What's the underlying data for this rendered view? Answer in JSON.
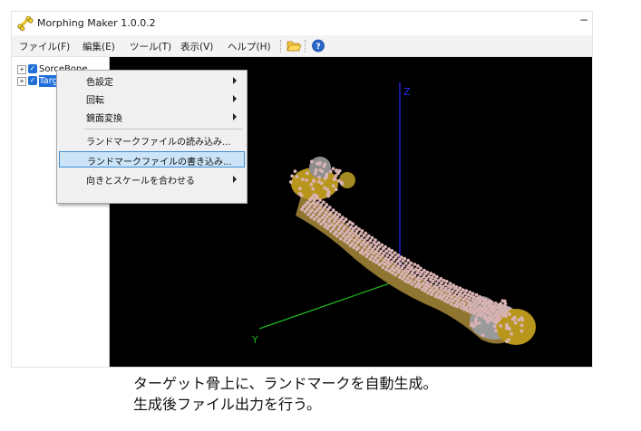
{
  "window": {
    "title": "Morphing Maker 1.0.0.2",
    "minimize_glyph": "−"
  },
  "menubar": {
    "items": [
      "ファイル(F)",
      "編集(E)",
      "ツール(T)",
      "表示(V)",
      "ヘルプ(H)"
    ],
    "toolbar": [
      {
        "name": "open-folder-icon"
      },
      {
        "name": "help-icon"
      }
    ]
  },
  "tree": {
    "items": [
      {
        "label": "SorceBone",
        "checked": true,
        "expander": "+"
      },
      {
        "label": "TargetBone",
        "checked": true,
        "expander": "+",
        "selected": true
      }
    ]
  },
  "viewport": {
    "axes": {
      "z": "Z",
      "y": "Y"
    },
    "colors": {
      "background": "#000000",
      "z_axis": "#2a2aff",
      "y_axis": "#1fb51f",
      "x_axis": "#8a1f1f",
      "bone_gold": "#b8961c",
      "bone_grey": "#9a9a9a",
      "landmark": "#d9b3b3"
    }
  },
  "context_menu": {
    "items": [
      {
        "label": "色設定",
        "submenu": true
      },
      {
        "label": "回転",
        "submenu": true
      },
      {
        "label": "鏡面変換",
        "submenu": true
      },
      {
        "label": "ランドマークファイルの読み込み...",
        "submenu": false
      },
      {
        "label": "ランドマークファイルの書き込み...",
        "submenu": false,
        "highlighted": true
      },
      {
        "label": "向きとスケールを合わせる",
        "submenu": true
      }
    ]
  },
  "caption": {
    "line1": "ターゲット骨上に、ランドマークを自動生成。",
    "line2": "生成後ファイル出力を行う。"
  }
}
